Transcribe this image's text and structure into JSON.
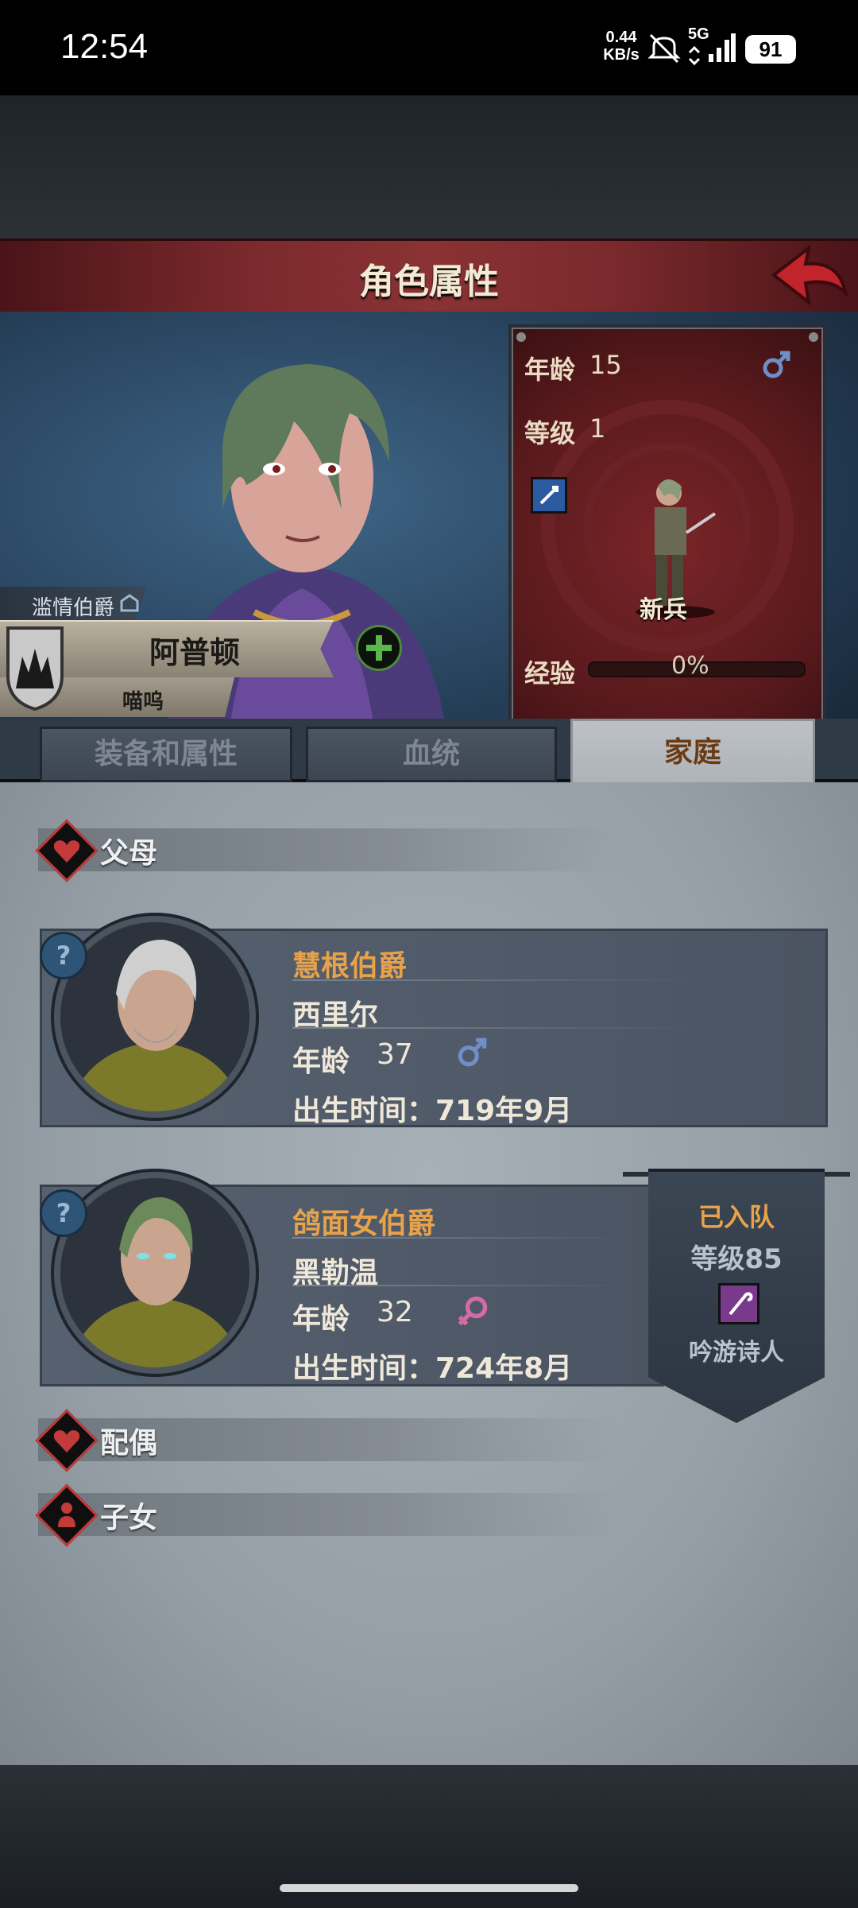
{
  "status_bar": {
    "time": "12:54",
    "net_speed_value": "0.44",
    "net_speed_unit": "KB/s",
    "network": "5G",
    "battery": "91"
  },
  "header": {
    "title": "角色属性",
    "back_icon": "back-arrow-icon"
  },
  "hero": {
    "rank": "滥情伯爵",
    "name": "阿普顿",
    "alias": "喵呜",
    "age_label": "年龄",
    "age": "15",
    "gender_icon": "male-icon",
    "level_label": "等级",
    "level": "1",
    "class_name": "新兵",
    "exp_label": "经验",
    "exp": "0%",
    "exp_fraction": 0
  },
  "tabs": [
    {
      "label": "装备和属性",
      "active": false
    },
    {
      "label": "血统",
      "active": false
    },
    {
      "label": "家庭",
      "active": true
    }
  ],
  "sections": {
    "parents": "父母",
    "spouse": "配偶",
    "children": "子女"
  },
  "father": {
    "title": "慧根伯爵",
    "name": "西里尔",
    "age_label": "年龄",
    "age": "37",
    "gender_icon": "male-icon",
    "birth": "出生时间：719年9月"
  },
  "mother": {
    "title": "鸽面女伯爵",
    "name": "黑勒温",
    "age_label": "年龄",
    "age": "32",
    "gender_icon": "female-icon",
    "birth": "出生时间：724年8月",
    "party_status": "已入队",
    "party_level": "等级85",
    "party_class": "吟游诗人"
  },
  "colors": {
    "title_bar": "#7c2a2d",
    "stat_panel": "#5a1a1d",
    "gold_text": "#e8a24a",
    "active_tab": "#aeb3b8"
  }
}
